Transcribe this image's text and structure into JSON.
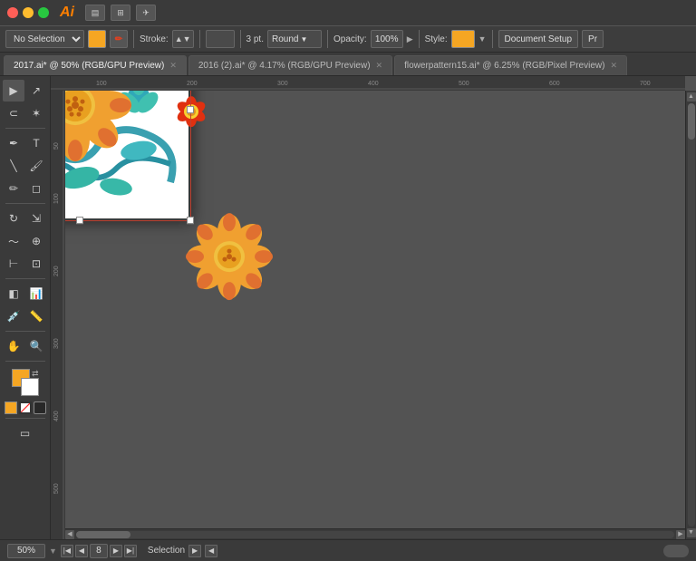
{
  "titlebar": {
    "app_name": "Ai",
    "icons": [
      "grid-icon",
      "layers-icon",
      "arrow-icon"
    ]
  },
  "toolbar": {
    "selection_label": "No Selection",
    "stroke_label": "Stroke:",
    "pt_label": "3 pt.",
    "round_label": "Round",
    "opacity_label": "Opacity:",
    "opacity_value": "100%",
    "style_label": "Style:",
    "document_setup_label": "Document Setup",
    "pr_label": "Pr"
  },
  "tabs": [
    {
      "label": "2017.ai* @ 50% (RGB/GPU Preview)",
      "active": true
    },
    {
      "label": "2016 (2).ai* @ 4.17% (RGB/GPU Preview)",
      "active": false
    },
    {
      "label": "flowerpattern15.ai* @ 6.25% (RGB/Pixel Preview)",
      "active": false
    }
  ],
  "statusbar": {
    "zoom_value": "50%",
    "page_number": "8",
    "tool_label": "Selection"
  },
  "colors": {
    "background": "#535353",
    "toolbar_bg": "#3d3d3d",
    "panel_bg": "#3a3a3a",
    "accent_orange": "#f5a623",
    "flower_orange": "#f0a030",
    "flower_red": "#e05020",
    "flower_teal": "#40b0b0",
    "flower_dark_blue": "#1060a0"
  }
}
